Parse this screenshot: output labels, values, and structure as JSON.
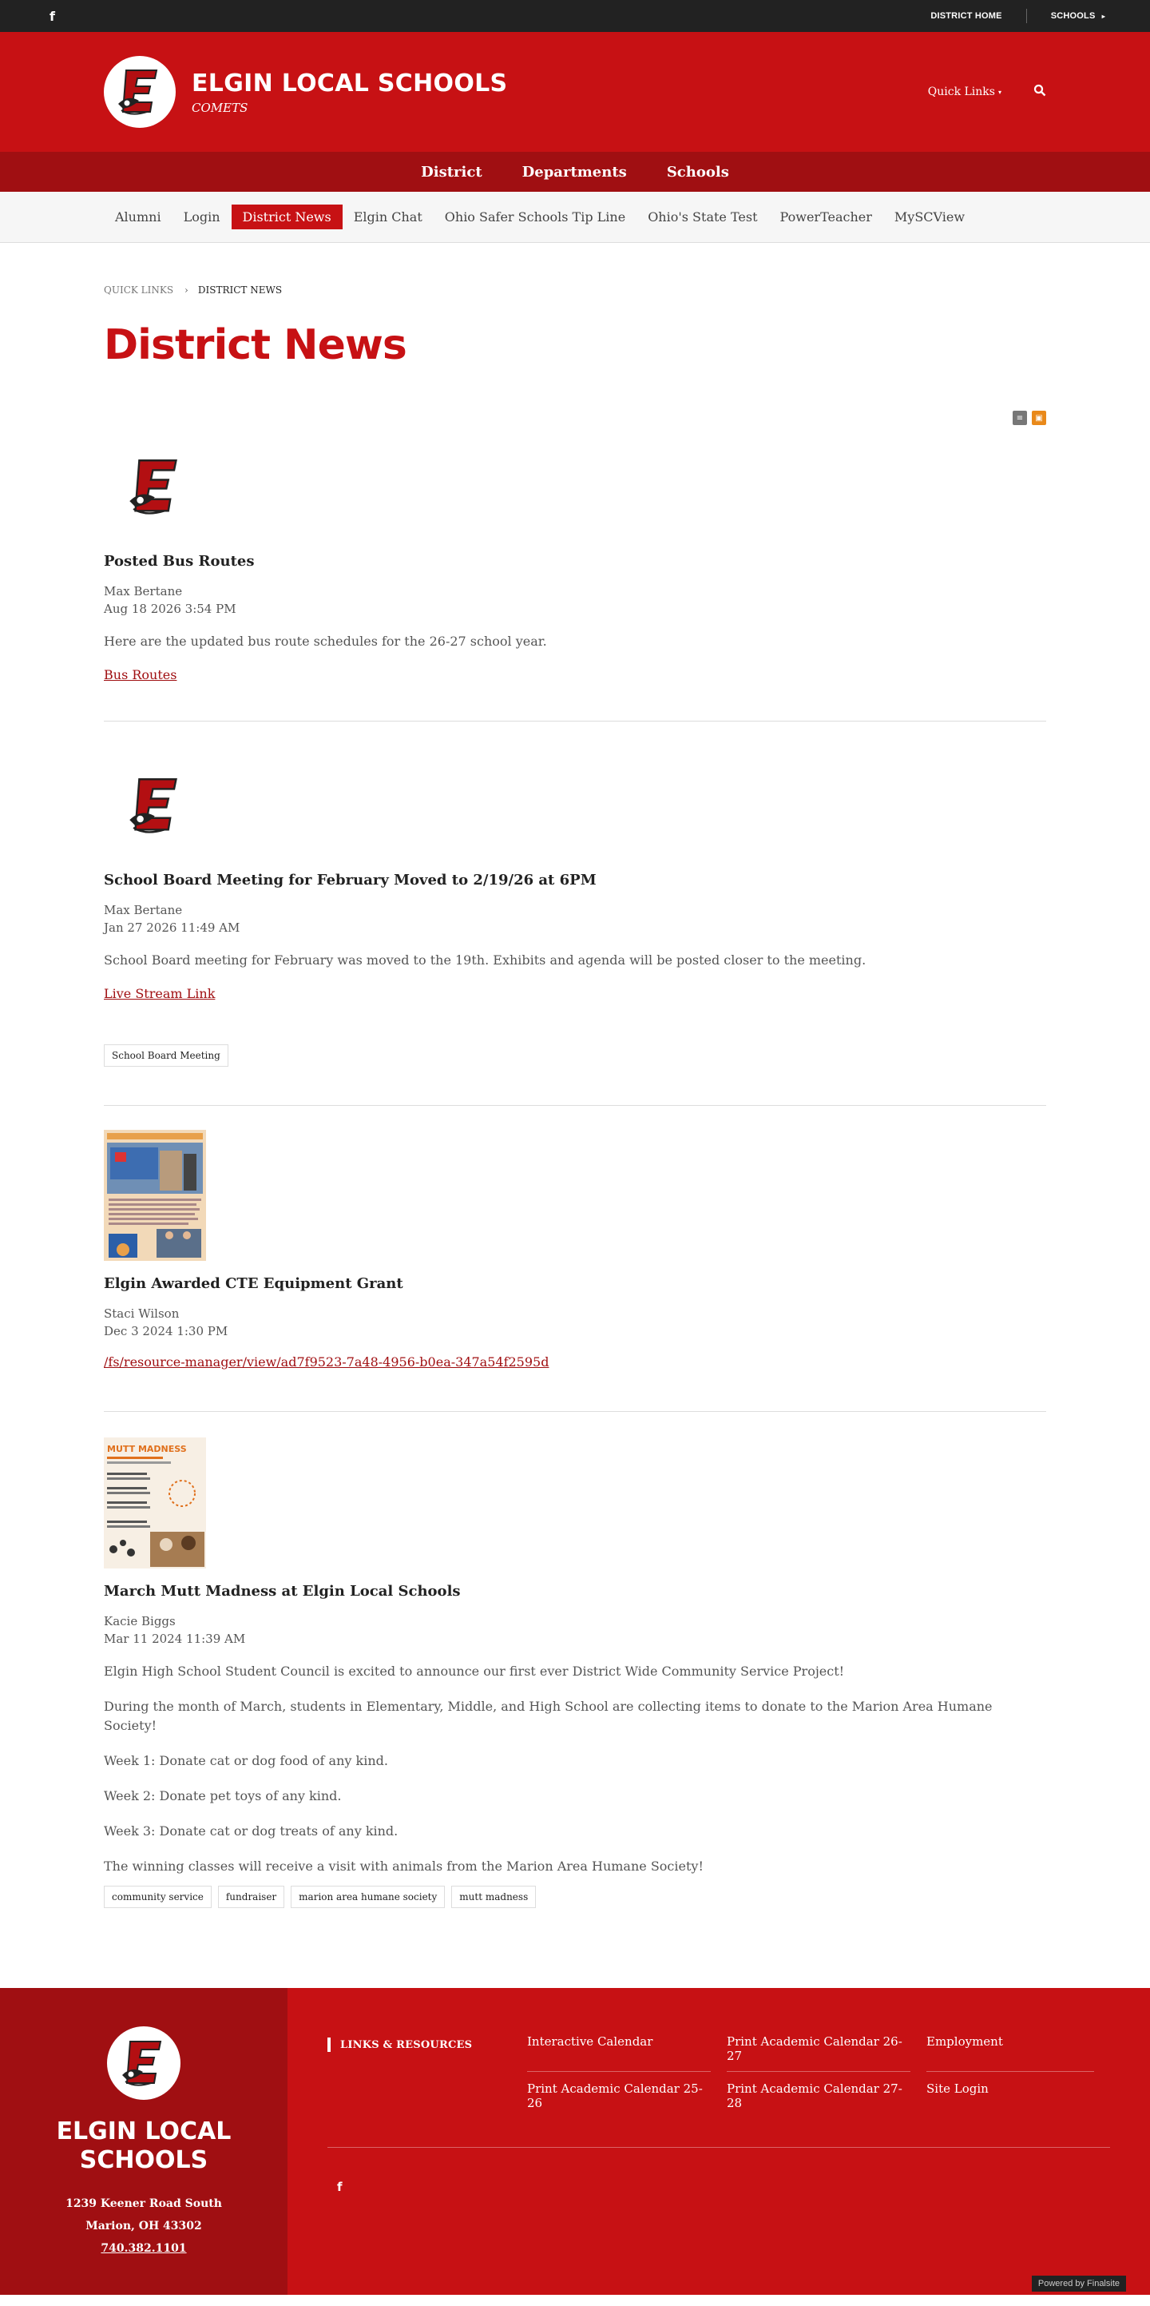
{
  "utility": {
    "facebook_glyph": "f",
    "district_home": "DISTRICT HOME",
    "schools": "SCHOOLS",
    "caret": "▸"
  },
  "header": {
    "name": "ELGIN LOCAL SCHOOLS",
    "tagline": "COMETS",
    "quick_links": "Quick Links",
    "caret": "▾",
    "search_glyph": "⌕"
  },
  "main_nav": [
    "District",
    "Departments",
    "Schools"
  ],
  "sub_nav": {
    "items": [
      "Alumni",
      "Login",
      "District News",
      "Elgin Chat",
      "Ohio Safer Schools Tip Line",
      "Ohio's State Test",
      "PowerTeacher",
      "MySCView"
    ],
    "active": "District News"
  },
  "breadcrumb": {
    "parent": "QUICK LINKS",
    "chevron": "›",
    "current": "DISTRICT NEWS"
  },
  "page_title": "District News",
  "feed_icons": {
    "rss_glyph": "≡",
    "ical_glyph": "▣"
  },
  "posts": [
    {
      "title": "Posted Bus Routes",
      "author": "Max Bertane",
      "date": "Aug 18 2026 3:54 PM",
      "body": [
        "Here are the updated bus route schedules for the 26-27 school year."
      ],
      "link": "Bus Routes"
    },
    {
      "title": "School Board Meeting for February Moved to 2/19/26 at 6PM",
      "author": "Max Bertane",
      "date": "Jan 27 2026 11:49 AM",
      "body": [
        "School Board meeting for February was moved to the 19th. Exhibits and agenda will be posted closer to the meeting."
      ],
      "link": "Live Stream Link",
      "tags": [
        "School Board Meeting"
      ]
    },
    {
      "title": "Elgin Awarded CTE Equipment Grant",
      "author": "Staci Wilson",
      "date": "Dec 3 2024 1:30 PM",
      "link": "/fs/resource-manager/view/ad7f9523-7a48-4956-b0ea-347a54f2595d"
    },
    {
      "title": "March Mutt Madness at Elgin Local Schools",
      "author": "Kacie Biggs",
      "date": "Mar 11 2024 11:39 AM",
      "thumb_heading": "MUTT MADNESS",
      "body": [
        "Elgin High School Student Council is excited to announce our first ever District Wide Community Service Project!",
        "During the month of March, students in Elementary, Middle, and High School are collecting items to donate to the Marion Area Humane Society!",
        "Week 1: Donate cat or dog food of any kind.",
        "Week 2: Donate pet toys of any kind.",
        "Week 3: Donate cat or dog treats of any kind.",
        "The winning classes will receive a visit with animals from the Marion Area Humane Society!"
      ],
      "tags": [
        "community service",
        "fundraiser",
        "marion area humane society",
        "mutt madness"
      ]
    }
  ],
  "footer": {
    "name": "ELGIN LOCAL SCHOOLS",
    "address_line1": "1239 Keener Road South",
    "address_line2": "Marion, OH  43302",
    "phone": "740.382.1101",
    "links_heading": "LINKS & RESOURCES",
    "links": [
      "Interactive Calendar",
      "Print Academic Calendar 26-27",
      "Employment",
      "Print Academic Calendar 25-26",
      "Print Academic Calendar 27-28",
      "Site Login"
    ],
    "facebook_glyph": "f",
    "powered_by": "Powered by Finalsite"
  },
  "colors": {
    "brand_red": "#c71114",
    "dark_red": "#a00f12",
    "utility_bg": "#222222"
  }
}
